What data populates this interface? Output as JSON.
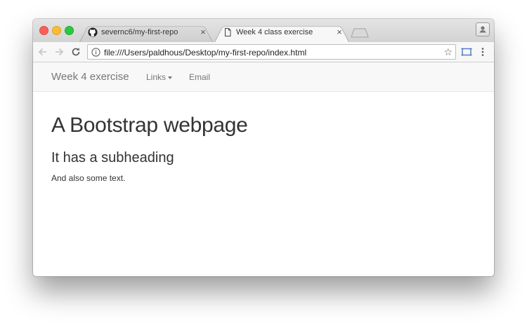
{
  "browser": {
    "tabs": [
      {
        "title": "severnc6/my-first-repo",
        "icon": "github-icon",
        "active": false
      },
      {
        "title": "Week 4 class exercise",
        "icon": "document-icon",
        "active": true
      }
    ],
    "close_glyph": "×",
    "url": "file:///Users/paldhous/Desktop/my-first-repo/index.html",
    "star_glyph": "☆"
  },
  "navbar": {
    "brand": "Week 4 exercise",
    "links_label": "Links",
    "email_label": "Email"
  },
  "content": {
    "heading": "A Bootstrap webpage",
    "subheading": "It has a subheading",
    "text": "And also some text."
  },
  "colors": {
    "close": "#fc5f57",
    "minimize": "#fdbc2e",
    "zoom": "#29c840",
    "navbar_bg": "#f8f8f8",
    "nav_text": "#777777",
    "heading_text": "#333333"
  }
}
